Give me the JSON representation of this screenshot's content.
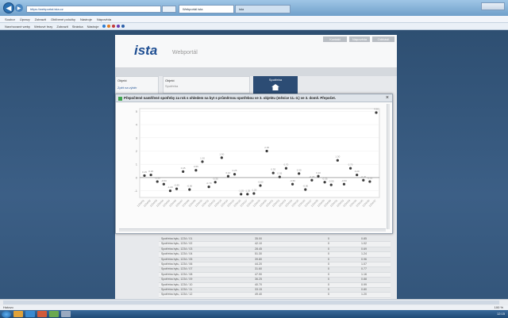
{
  "browser": {
    "address": "https://webportal.ista.cz",
    "tabs": [
      "Webportál ista",
      "ista"
    ],
    "menu": [
      "Soubor",
      "Úpravy",
      "Zobrazit",
      "Oblíbené položky",
      "Nástroje",
      "Nápověda"
    ],
    "favorites": [
      "Navrhované weby",
      "Webové řezy",
      "Zobrazit",
      "Stránka",
      "Nástroje"
    ],
    "status": "Hotovo",
    "zoom": "100 %",
    "clock": "12:15"
  },
  "portal": {
    "logo": "ista",
    "subtitle": "Webportál",
    "header_buttons": [
      "Kontakt",
      "Nápověda",
      "Odhlásit"
    ],
    "left_box_label": "Objekt",
    "left_box_link": "Zpět na výběr",
    "step1_label": "Objekt",
    "step1_text": "Spotřeba",
    "step2_label": "Spotřeba"
  },
  "modal": {
    "title": "Přepočtené naměřené spotřeby za rok s ohledem na byt s průměrnou spotřebou ve 3. objektu (měsíce 11.-3.) ve 3. domě. Přepočet.",
    "close": "×"
  },
  "table": {
    "rows": [
      [
        "Spotřeba bytu, 1234 / 01",
        "35.00",
        "0",
        "0.85"
      ],
      [
        "Spotřeba bytu, 1234 / 02",
        "42.10",
        "0",
        "1.02"
      ],
      [
        "Spotřeba bytu, 1234 / 03",
        "28.45",
        "0",
        "0.69"
      ],
      [
        "Spotřeba bytu, 1234 / 04",
        "51.30",
        "0",
        "1.24"
      ],
      [
        "Spotřeba bytu, 1234 / 05",
        "39.80",
        "0",
        "0.96"
      ],
      [
        "Spotřeba bytu, 1234 / 06",
        "44.20",
        "0",
        "1.07"
      ],
      [
        "Spotřeba bytu, 1234 / 07",
        "31.60",
        "0",
        "0.77"
      ],
      [
        "Spotřeba bytu, 1234 / 08",
        "47.90",
        "0",
        "1.16"
      ],
      [
        "Spotřeba bytu, 1234 / 09",
        "36.25",
        "0",
        "0.88"
      ],
      [
        "Spotřeba bytu, 1234 / 10",
        "40.70",
        "0",
        "0.99"
      ],
      [
        "Spotřeba bytu, 1234 / 11",
        "33.15",
        "0",
        "0.80"
      ],
      [
        "Spotřeba bytu, 1234 / 12",
        "49.40",
        "0",
        "1.20"
      ]
    ]
  },
  "chart_data": {
    "type": "scatter",
    "title": "",
    "xlabel": "",
    "ylabel": "",
    "ylim": [
      -1.5,
      5.2
    ],
    "yticks": [
      -1,
      0,
      1,
      2,
      3,
      4,
      5
    ],
    "grid": true,
    "reference_line": 0,
    "x": [
      "1234/01",
      "1234/02",
      "1234/03",
      "1234/04",
      "1234/05",
      "1234/06",
      "1234/07",
      "1234/08",
      "1234/09",
      "1234/10",
      "1234/11",
      "1234/12",
      "1234/13",
      "1234/14",
      "1234/15",
      "1234/16",
      "1234/17",
      "1234/18",
      "1234/19",
      "1234/20",
      "1234/21",
      "1234/22",
      "1234/23",
      "1234/24",
      "1234/25",
      "1234/26",
      "1234/27",
      "1234/28",
      "1234/29",
      "1234/30",
      "1234/31",
      "1234/32",
      "1234/33",
      "1234/34",
      "1234/35",
      "1234/36",
      "1234/37"
    ],
    "y": [
      0.15,
      0.2,
      -0.3,
      -0.5,
      -1.0,
      -0.85,
      0.45,
      -0.9,
      0.55,
      1.2,
      -0.7,
      -0.35,
      1.5,
      0.1,
      0.25,
      -1.25,
      -1.25,
      -1.2,
      -0.6,
      2.0,
      0.35,
      0.05,
      0.7,
      -0.5,
      0.3,
      -0.9,
      -0.2,
      0.1,
      -0.35,
      -0.55,
      1.3,
      -0.5,
      0.7,
      0.2,
      -0.2,
      -0.3,
      4.9
    ],
    "point_color": "#3a3a3a",
    "label_color": "#8a8a8a"
  }
}
